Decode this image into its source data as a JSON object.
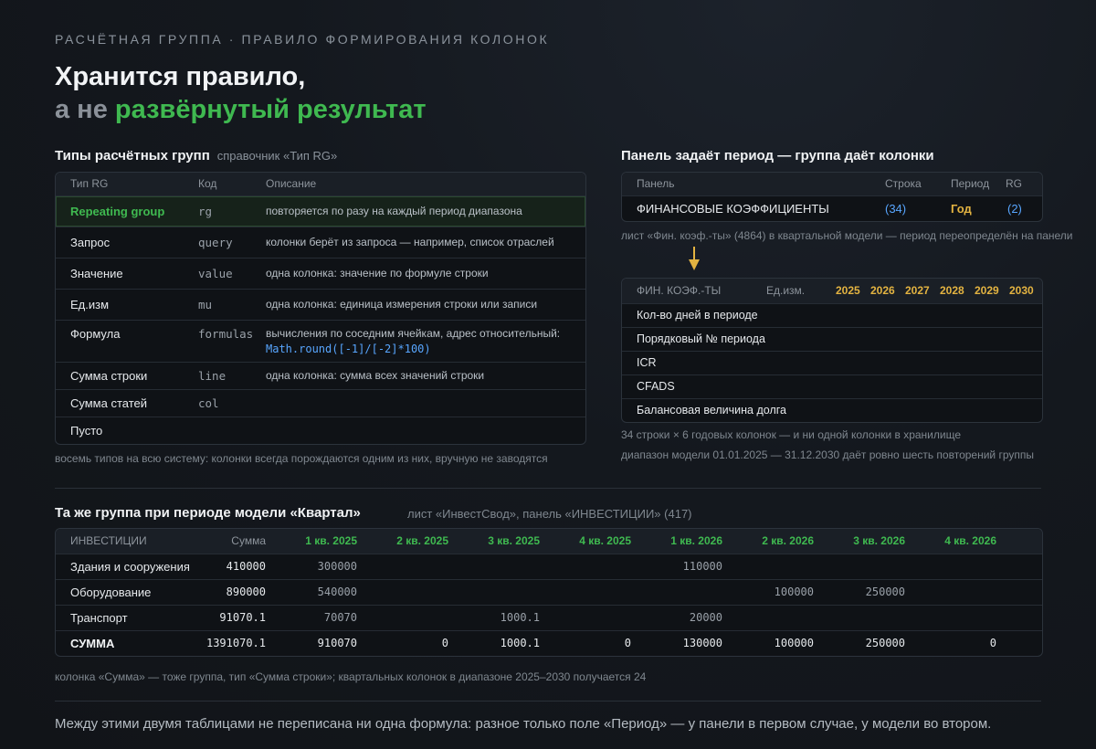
{
  "eyebrow": "РАСЧЁТНАЯ ГРУППА · ПРАВИЛО ФОРМИРОВАНИЯ КОЛОНОК",
  "headline": {
    "line1": "Хранится правило,",
    "line2_muted": "а не",
    "line2_green": "развёрнутый результат"
  },
  "types": {
    "title": "Типы расчётных групп",
    "subtitle": "справочник «Тип RG»",
    "headers": {
      "type": "Тип RG",
      "code": "Код",
      "desc": "Описание"
    },
    "rows": [
      {
        "type": "Repeating group",
        "code": "rg",
        "desc": "повторяется по разу на каждый период диапазона"
      },
      {
        "type": "Запрос",
        "code": "query",
        "desc": "колонки берёт из запроса — например, список отраслей"
      },
      {
        "type": "Значение",
        "code": "value",
        "desc": "одна колонка: значение по формуле строки"
      },
      {
        "type": "Ед.изм",
        "code": "mu",
        "desc": "одна колонка: единица измерения строки или записи"
      },
      {
        "type": "Формула",
        "code": "formulas",
        "desc": "вычисления по соседним ячейкам, адрес относительный:",
        "desc_code": "Math.round([-1]/[-2]*100)"
      },
      {
        "type": "Сумма строки",
        "code": "line",
        "desc": "одна колонка: сумма всех значений строки"
      },
      {
        "type": "Сумма статей",
        "code": "col",
        "desc": ""
      },
      {
        "type": "Пусто",
        "code": "",
        "desc": ""
      }
    ],
    "note": "восемь типов на всю систему: колонки всегда порождаются одним из них, вручную не заводятся"
  },
  "panel": {
    "title": "Панель задаёт период — группа даёт колонки",
    "headers": {
      "panel": "Панель",
      "row": "Строка",
      "period": "Период",
      "rg": "RG"
    },
    "row": {
      "panel": "ФИНАНСОВЫЕ КОЭФФИЦИЕНТЫ",
      "row": "(34)",
      "period": "Год",
      "rg": "(2)"
    },
    "note": "лист «Фин. коэф.-ты» (4864) в квартальной модели — период переопределён на панели"
  },
  "fin": {
    "headers": {
      "name": "ФИН. КОЭФ.-ТЫ",
      "unit": "Ед.изм.",
      "years": [
        "2025",
        "2026",
        "2027",
        "2028",
        "2029",
        "2030"
      ]
    },
    "rows": [
      "Кол-во дней в периоде",
      "Порядковый № периода",
      "ICR",
      "CFADS",
      "Балансовая величина долга"
    ],
    "note1": "34 строки × 6 годовых колонок — и ни одной колонки в хранилище",
    "note2": "диапазон модели 01.01.2025 — 31.12.2030 даёт ровно шесть повторений группы"
  },
  "invest": {
    "title": "Та же группа при периоде модели «Квартал»",
    "subtitle": "лист «ИнвестСвод», панель «ИНВЕСТИЦИИ» (417)",
    "headers": {
      "name": "ИНВЕСТИЦИИ",
      "sum": "Сумма",
      "quarters": [
        "1 кв. 2025",
        "2 кв. 2025",
        "3 кв. 2025",
        "4 кв. 2025",
        "1 кв. 2026",
        "2 кв. 2026",
        "3 кв. 2026",
        "4 кв. 2026"
      ]
    },
    "rows": [
      {
        "name": "Здания и сооружения",
        "sum": "410000",
        "q": [
          "300000",
          "",
          "",
          "",
          "110000",
          "",
          "",
          ""
        ]
      },
      {
        "name": "Оборудование",
        "sum": "890000",
        "q": [
          "540000",
          "",
          "",
          "",
          "",
          "100000",
          "250000",
          ""
        ]
      },
      {
        "name": "Транспорт",
        "sum": "91070.1",
        "q": [
          "70070",
          "",
          "1000.1",
          "",
          "20000",
          "",
          "",
          ""
        ]
      },
      {
        "name": "СУММА",
        "sum": "1391070.1",
        "q": [
          "910070",
          "0",
          "1000.1",
          "0",
          "130000",
          "100000",
          "250000",
          "0"
        ]
      }
    ],
    "note": "колонка «Сумма» — тоже группа, тип «Сумма строки»; квартальных колонок в диапазоне 2025–2030 получается 24"
  },
  "footer": "Между этими двумя таблицами не переписана ни одна формула: разное только поле «Период» — у панели в первом случае, у модели во втором.",
  "colors": {
    "green": "#3fb950",
    "gold": "#e3b341",
    "blue": "#58a6ff",
    "bg": "#14181e"
  }
}
